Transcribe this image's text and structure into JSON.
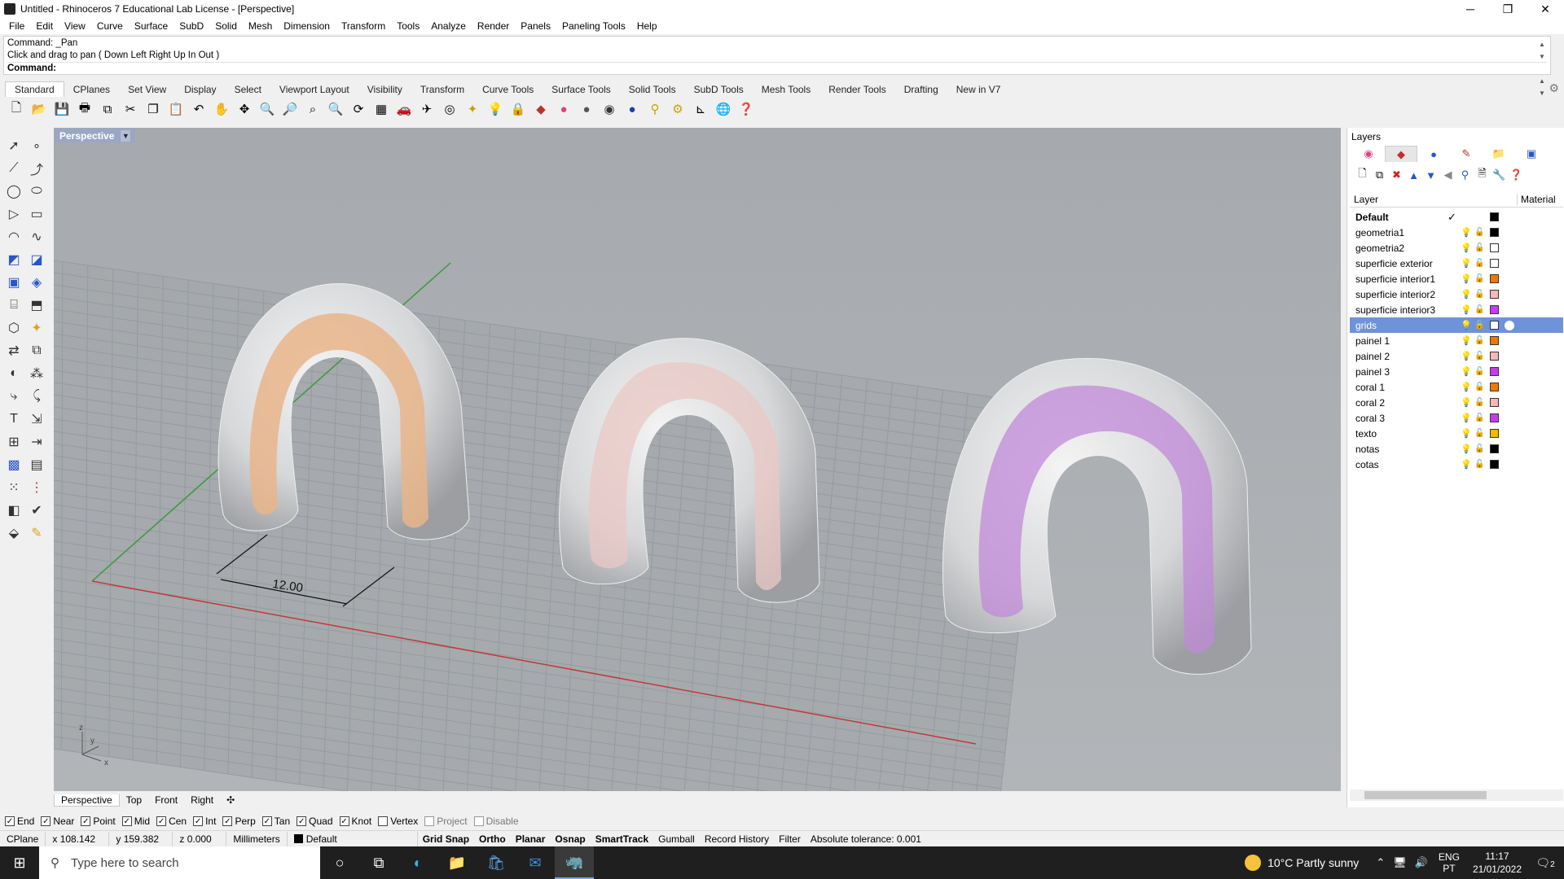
{
  "window": {
    "title": "Untitled - Rhinoceros 7 Educational Lab License - [Perspective]",
    "minimize": "─",
    "maximize": "❐",
    "close": "✕"
  },
  "menu": [
    "File",
    "Edit",
    "View",
    "Curve",
    "Surface",
    "SubD",
    "Solid",
    "Mesh",
    "Dimension",
    "Transform",
    "Tools",
    "Analyze",
    "Render",
    "Panels",
    "Paneling Tools",
    "Help"
  ],
  "command": {
    "history1": "Command: _Pan",
    "history2": "Click and drag to pan ( Down  Left  Right  Up  In  Out )",
    "prompt": "Command:"
  },
  "toolbar_tabs": [
    "Standard",
    "CPlanes",
    "Set View",
    "Display",
    "Select",
    "Viewport Layout",
    "Visibility",
    "Transform",
    "Curve Tools",
    "Surface Tools",
    "Solid Tools",
    "SubD Tools",
    "Mesh Tools",
    "Render Tools",
    "Drafting",
    "New in V7"
  ],
  "viewport": {
    "name": "Perspective",
    "dimension_text": "12.00",
    "axis_z": "z",
    "axis_y": "y",
    "axis_x": "x"
  },
  "viewport_tabs": [
    "Perspective",
    "Top",
    "Front",
    "Right"
  ],
  "layers_panel": {
    "title": "Layers",
    "col_layer": "Layer",
    "col_material": "Material",
    "rows": [
      {
        "name": "Default",
        "color": "#000000",
        "current": true
      },
      {
        "name": "geometria1",
        "color": "#000000"
      },
      {
        "name": "geometria2",
        "color": "#ffffff"
      },
      {
        "name": "superficie exterior",
        "color": "#ffffff"
      },
      {
        "name": "superficie interior1",
        "color": "#f07800"
      },
      {
        "name": "superficie interior2",
        "color": "#f5b8b8"
      },
      {
        "name": "superficie interior3",
        "color": "#c83cf0"
      },
      {
        "name": "grids",
        "color": "#ffffff",
        "selected": true
      },
      {
        "name": "painel 1",
        "color": "#f07800"
      },
      {
        "name": "painel 2",
        "color": "#f5b8b8"
      },
      {
        "name": "painel 3",
        "color": "#c83cf0"
      },
      {
        "name": "coral 1",
        "color": "#f07800"
      },
      {
        "name": "coral 2",
        "color": "#f5b8b8"
      },
      {
        "name": "coral 3",
        "color": "#c83cf0"
      },
      {
        "name": "texto",
        "color": "#f5b800"
      },
      {
        "name": "notas",
        "color": "#000000"
      },
      {
        "name": "cotas",
        "color": "#000000"
      }
    ]
  },
  "osnaps": [
    {
      "label": "End",
      "checked": true
    },
    {
      "label": "Near",
      "checked": true
    },
    {
      "label": "Point",
      "checked": true
    },
    {
      "label": "Mid",
      "checked": true
    },
    {
      "label": "Cen",
      "checked": true
    },
    {
      "label": "Int",
      "checked": true
    },
    {
      "label": "Perp",
      "checked": true
    },
    {
      "label": "Tan",
      "checked": true
    },
    {
      "label": "Quad",
      "checked": true
    },
    {
      "label": "Knot",
      "checked": true
    },
    {
      "label": "Vertex",
      "checked": false
    },
    {
      "label": "Project",
      "checked": false,
      "disabled": true
    },
    {
      "label": "Disable",
      "checked": false,
      "disabled": true
    }
  ],
  "status": {
    "cplane": "CPlane",
    "x": "x 108.142",
    "y": "y 159.382",
    "z": "z 0.000",
    "units": "Millimeters",
    "layer": "Default",
    "grid_snap": "Grid Snap",
    "ortho": "Ortho",
    "planar": "Planar",
    "osnap": "Osnap",
    "smarttrack": "SmartTrack",
    "gumball": "Gumball",
    "record_history": "Record History",
    "filter": "Filter",
    "tolerance": "Absolute tolerance: 0.001"
  },
  "taskbar": {
    "search_placeholder": "Type here to search",
    "weather": "10°C  Partly sunny",
    "lang1": "ENG",
    "lang2": "PT",
    "time": "11:17",
    "date": "21/01/2022",
    "notifications": "2"
  }
}
